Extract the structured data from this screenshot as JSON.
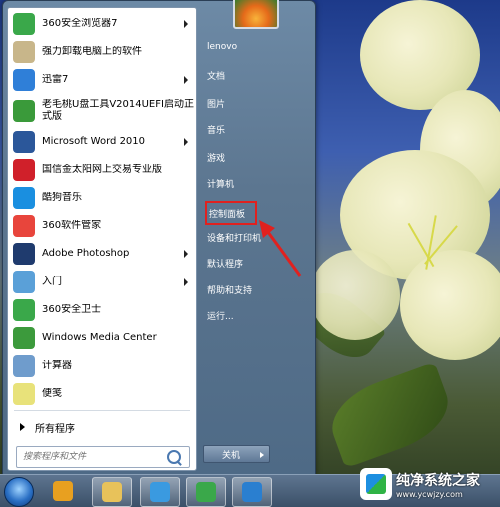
{
  "programs": [
    {
      "label": "360安全浏览器7",
      "icon": "360-browser-icon",
      "color": "#3aa84a",
      "has_submenu": true
    },
    {
      "label": "强力卸载电脑上的软件",
      "icon": "uninstall-icon",
      "color": "#c8b68a",
      "has_submenu": false
    },
    {
      "label": "迅雷7",
      "icon": "thunder-icon",
      "color": "#2f7fd8",
      "has_submenu": true
    },
    {
      "label": "老毛桃U盘工具V2014UEFI启动正式版",
      "icon": "laomaotao-icon",
      "color": "#3a9a3a",
      "has_submenu": false
    },
    {
      "label": "Microsoft Word 2010",
      "icon": "word-icon",
      "color": "#2b579a",
      "has_submenu": true
    },
    {
      "label": "国信金太阳网上交易专业版",
      "icon": "guoxin-icon",
      "color": "#d0202a",
      "has_submenu": false
    },
    {
      "label": "酷狗音乐",
      "icon": "kugou-icon",
      "color": "#1a8fe0",
      "has_submenu": false
    },
    {
      "label": "360软件管家",
      "icon": "360-software-icon",
      "color": "#e8453c",
      "has_submenu": false
    },
    {
      "label": "Adobe Photoshop",
      "icon": "photoshop-icon",
      "color": "#1f3b6e",
      "has_submenu": true
    },
    {
      "label": "入门",
      "icon": "getting-started-icon",
      "color": "#5aa0d8",
      "has_submenu": true
    },
    {
      "label": "360安全卫士",
      "icon": "360-safe-icon",
      "color": "#3aa84a",
      "has_submenu": false
    },
    {
      "label": "Windows Media Center",
      "icon": "media-center-icon",
      "color": "#3c9a3c",
      "has_submenu": false
    },
    {
      "label": "计算器",
      "icon": "calculator-icon",
      "color": "#6f9ccc",
      "has_submenu": false
    },
    {
      "label": "便笺",
      "icon": "sticky-notes-icon",
      "color": "#e8e27a",
      "has_submenu": false
    }
  ],
  "all_programs": "所有程序",
  "search": {
    "placeholder": "搜索程序和文件"
  },
  "right_items": [
    {
      "label": "lenovo"
    },
    {
      "label": "文档"
    },
    {
      "label": "图片"
    },
    {
      "label": "音乐"
    },
    {
      "label": "游戏"
    },
    {
      "label": "计算机"
    },
    {
      "label": "控制面板",
      "highlight": true
    },
    {
      "label": "设备和打印机"
    },
    {
      "label": "默认程序"
    },
    {
      "label": "帮助和支持"
    },
    {
      "label": "运行..."
    }
  ],
  "shutdown_label": "关机",
  "taskbar": {
    "items": [
      {
        "icon": "pinwheel-app-icon",
        "color": "#e8a020"
      },
      {
        "icon": "file-explorer-icon",
        "color": "#e8c25a"
      },
      {
        "icon": "cloud-icon",
        "color": "#3a9ae0"
      },
      {
        "icon": "360-browser-icon",
        "color": "#3aa84a"
      },
      {
        "icon": "tool-app-icon",
        "color": "#2a7fd0"
      }
    ]
  },
  "watermark": {
    "title": "纯净系统之家",
    "url": "www.ycwjzy.com"
  }
}
